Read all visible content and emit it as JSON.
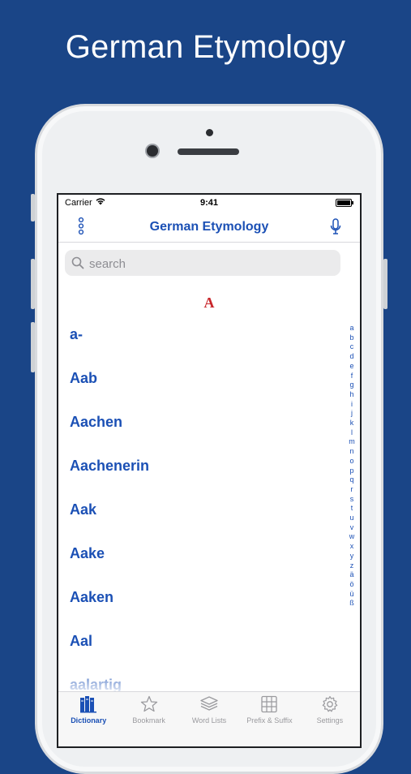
{
  "headline": "German Etymology",
  "status_bar": {
    "carrier": "Carrier",
    "time": "9:41"
  },
  "navbar": {
    "title": "German Etymology",
    "left_icon": "menu-dots-icon",
    "right_icon": "microphone-icon"
  },
  "search": {
    "placeholder": "search"
  },
  "section_letter": "A",
  "entries": [
    "a-",
    "Aab",
    "Aachen",
    "Aachenerin",
    "Aak",
    "Aake",
    "Aaken",
    "Aal",
    "aalartig"
  ],
  "index_letters": [
    "a",
    "b",
    "c",
    "d",
    "e",
    "f",
    "g",
    "h",
    "i",
    "j",
    "k",
    "l",
    "m",
    "n",
    "o",
    "p",
    "q",
    "r",
    "s",
    "t",
    "u",
    "v",
    "w",
    "x",
    "y",
    "z",
    "ä",
    "ö",
    "ü",
    "ß"
  ],
  "tabs": [
    {
      "label": "Dictionary",
      "icon": "books-icon",
      "active": true
    },
    {
      "label": "Bookmark",
      "icon": "star-icon",
      "active": false
    },
    {
      "label": "Word Lists",
      "icon": "stack-icon",
      "active": false
    },
    {
      "label": "Prefix & Suffix",
      "icon": "grid-book-icon",
      "active": false
    },
    {
      "label": "Settings",
      "icon": "gear-icon",
      "active": false
    }
  ],
  "colors": {
    "background": "#1a4587",
    "accent": "#1b50b5",
    "section_letter": "#c8262b"
  }
}
